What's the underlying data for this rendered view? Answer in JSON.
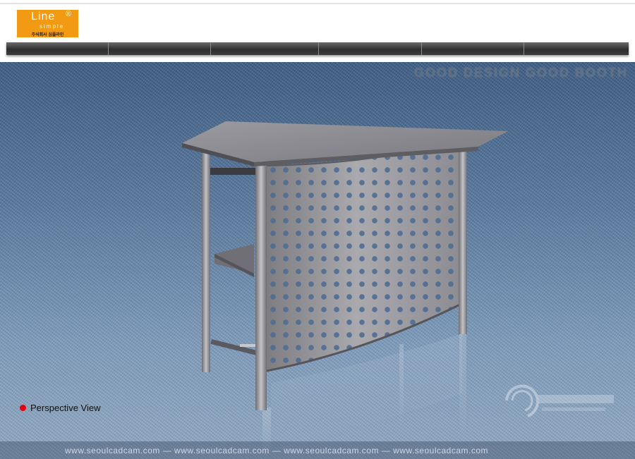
{
  "header": {
    "logo": {
      "main": "Line",
      "registered": "®",
      "sub": "simple",
      "caption": "주식회사 심플라인"
    },
    "nav_item_count": 6
  },
  "scene": {
    "tagline": "GOOD DESIGN GOOD BOOTH",
    "view_label": "Perspective View",
    "footer_watermark": "www.seoulcadcam.com — www.seoulcadcam.com — www.seoulcadcam.com — www.seoulcadcam.com",
    "colors": {
      "accent_orange": "#f39a14",
      "bullet_red": "#e3000f"
    }
  }
}
